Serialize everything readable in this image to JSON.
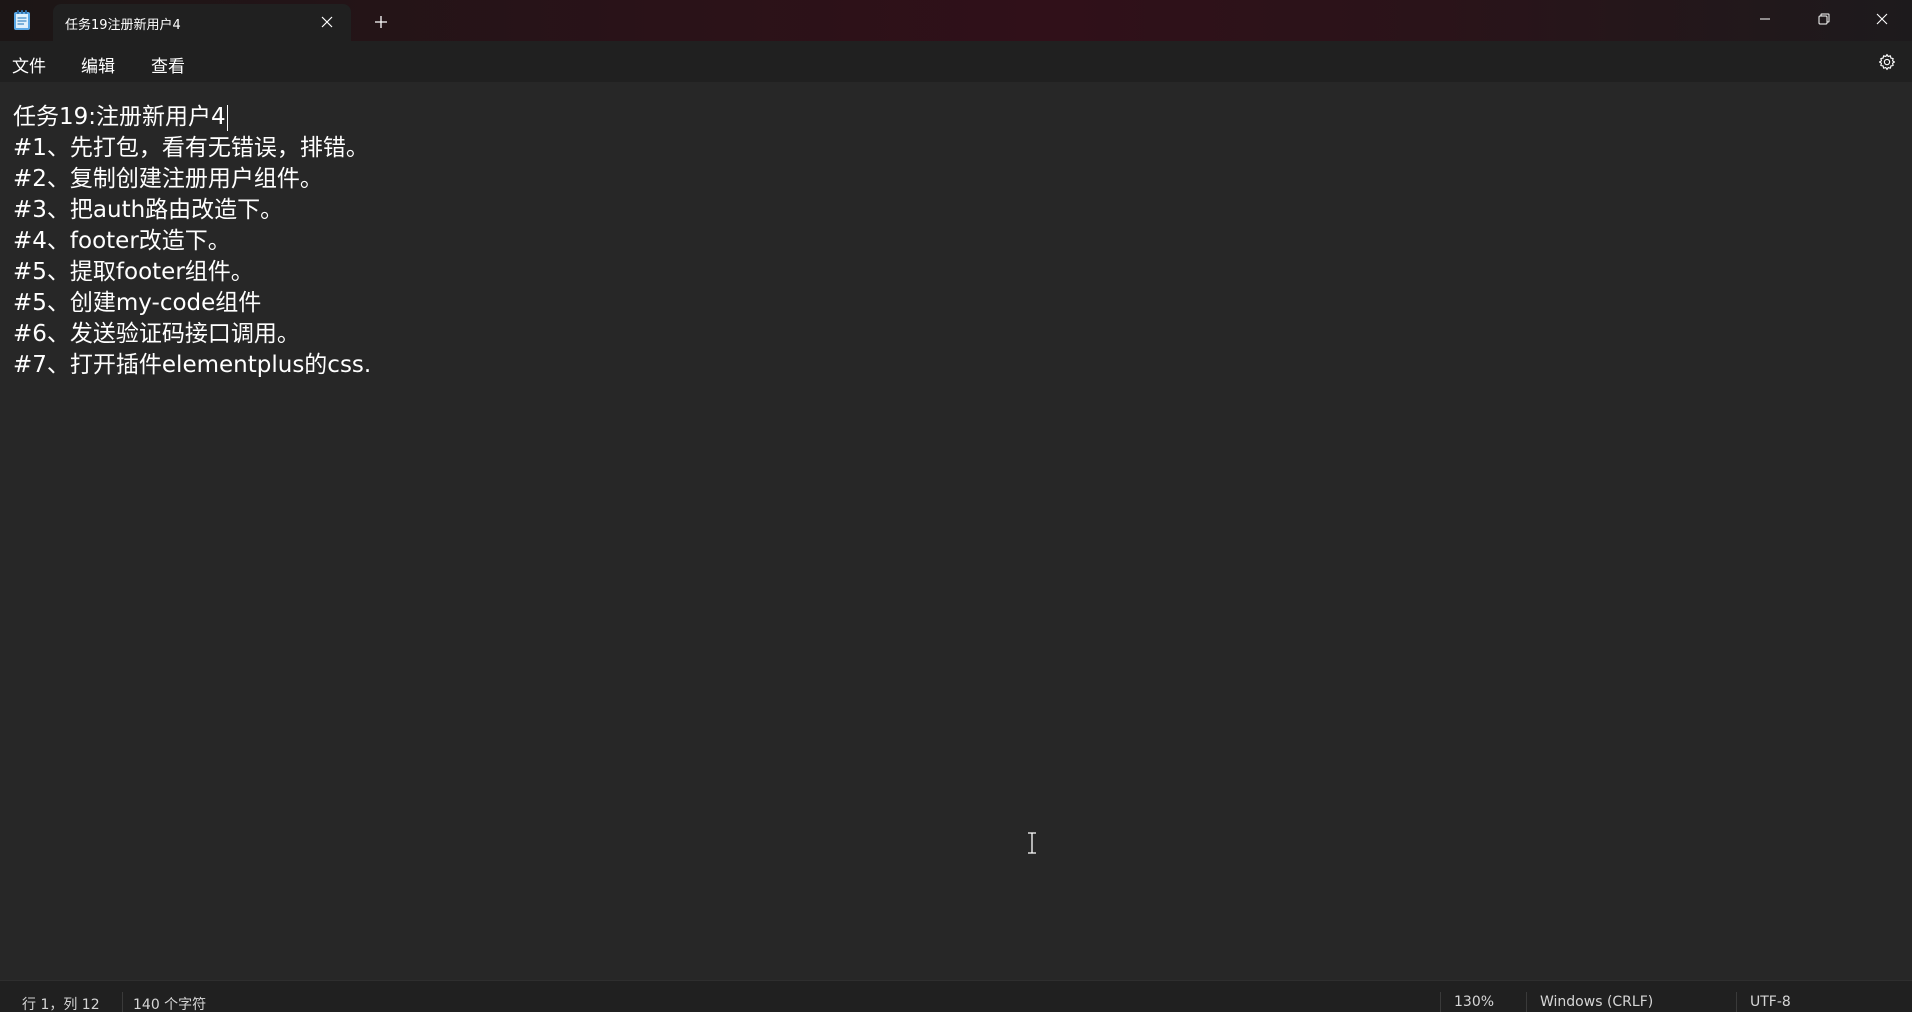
{
  "window": {
    "tab_title": "任务19注册新用户4",
    "icons": {
      "app": "notepad-icon",
      "tab_close": "close-icon",
      "new_tab": "plus-icon",
      "minimize": "minimize-icon",
      "maximize": "restore-icon",
      "close": "close-icon"
    }
  },
  "menubar": {
    "file": "文件",
    "edit": "编辑",
    "view": "查看",
    "settings_icon": "gear-icon"
  },
  "editor": {
    "lines": [
      "任务19:注册新用户4",
      "#1、先打包，看有无错误，排错。",
      "#2、复制创建注册用户组件。",
      "#3、把auth路由改造下。",
      "#4、footer改造下。",
      "#5、提取footer组件。",
      "#5、创建my-code组件",
      "#6、发送验证码接口调用。",
      "#7、打开插件elementplus的css."
    ]
  },
  "statusbar": {
    "position": "行 1，列 12",
    "char_count": "140 个字符",
    "zoom": "130%",
    "line_ending": "Windows (CRLF)",
    "encoding": "UTF-8"
  },
  "colors": {
    "background": "#272727",
    "chrome": "#202020",
    "text": "#ffffff",
    "status_text": "#d6d6d6"
  }
}
